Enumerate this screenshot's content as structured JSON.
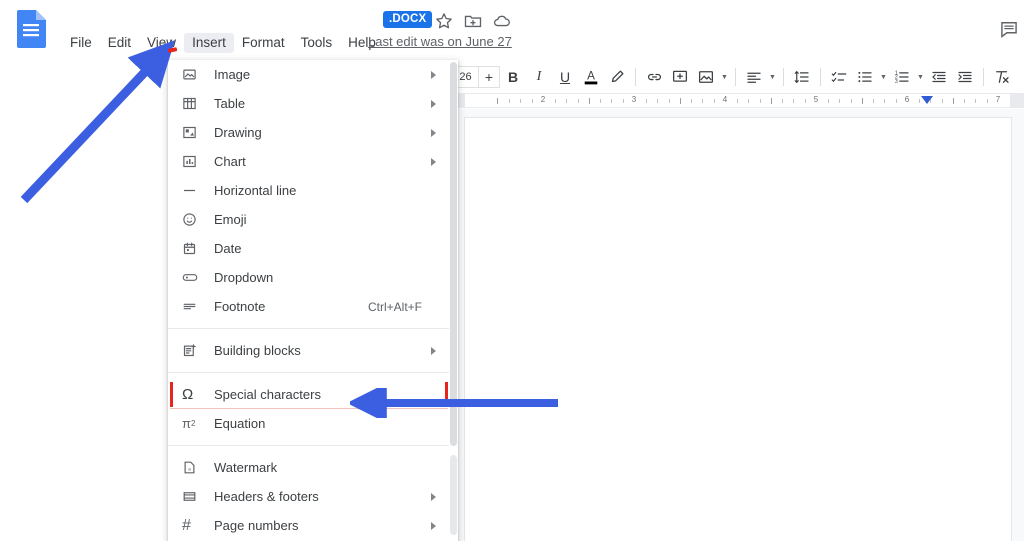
{
  "app": {
    "name": "Google Docs",
    "logo_icon": "google-docs-logo-icon"
  },
  "header": {
    "menus": [
      {
        "label": "File",
        "name": "menu-file",
        "active": false
      },
      {
        "label": "Edit",
        "name": "menu-edit",
        "active": false
      },
      {
        "label": "View",
        "name": "menu-view",
        "active": false
      },
      {
        "label": "Insert",
        "name": "menu-insert",
        "active": true
      },
      {
        "label": "Format",
        "name": "menu-format",
        "active": false
      },
      {
        "label": "Tools",
        "name": "menu-tools",
        "active": false
      },
      {
        "label": "Help",
        "name": "menu-help",
        "active": false
      }
    ],
    "last_edit": "Last edit was on June 27",
    "format_badge": ".DOCX",
    "badge_color": "#1a73e8",
    "icons": [
      {
        "name": "star-icon",
        "glyph": "star"
      },
      {
        "name": "move-to-folder-icon",
        "glyph": "folder-move"
      },
      {
        "name": "cloud-saved-icon",
        "glyph": "cloud"
      },
      {
        "name": "open-comment-history-icon",
        "glyph": "comment"
      }
    ]
  },
  "toolbar": {
    "font_size": "26",
    "font_size_increase": "+",
    "items": [
      {
        "name": "bold-button",
        "label": "B"
      },
      {
        "name": "italic-button",
        "label": "I"
      },
      {
        "name": "underline-button",
        "label": "U"
      },
      {
        "name": "text-color-button",
        "label": "A"
      },
      {
        "name": "highlight-color-button",
        "label": "pen-icon"
      },
      {
        "name": "insert-link-button",
        "label": "link-icon"
      },
      {
        "name": "add-comment-button",
        "label": "comment-plus-icon"
      },
      {
        "name": "insert-image-button",
        "label": "image-icon"
      },
      {
        "name": "align-button",
        "label": "align-left-icon"
      },
      {
        "name": "line-spacing-button",
        "label": "line-spacing-icon"
      },
      {
        "name": "checklist-button",
        "label": "checklist-icon"
      },
      {
        "name": "bulleted-list-button",
        "label": "bulleted-list-icon"
      },
      {
        "name": "numbered-list-button",
        "label": "numbered-list-icon"
      },
      {
        "name": "decrease-indent-button",
        "label": "decrease-indent-icon"
      },
      {
        "name": "increase-indent-button",
        "label": "increase-indent-icon"
      },
      {
        "name": "clear-formatting-button",
        "label": "clear-formatting-icon"
      }
    ]
  },
  "ruler": {
    "numbers": [
      "2",
      "3",
      "4",
      "5",
      "6",
      "7"
    ],
    "indent_marker": "right-indent-marker"
  },
  "insert_menu": {
    "items": [
      {
        "type": "item",
        "label": "Image",
        "icon": "image-icon",
        "name": "insert-menu-image",
        "submenu": true,
        "accel": ""
      },
      {
        "type": "item",
        "label": "Table",
        "icon": "table-icon",
        "name": "insert-menu-table",
        "submenu": true,
        "accel": ""
      },
      {
        "type": "item",
        "label": "Drawing",
        "icon": "drawing-icon",
        "name": "insert-menu-drawing",
        "submenu": true,
        "accel": ""
      },
      {
        "type": "item",
        "label": "Chart",
        "icon": "chart-icon",
        "name": "insert-menu-chart",
        "submenu": true,
        "accel": ""
      },
      {
        "type": "item",
        "label": "Horizontal line",
        "icon": "horizontal-line-icon",
        "name": "insert-menu-horizontal-line",
        "submenu": false,
        "accel": ""
      },
      {
        "type": "item",
        "label": "Emoji",
        "icon": "emoji-icon",
        "name": "insert-menu-emoji",
        "submenu": false,
        "accel": ""
      },
      {
        "type": "item",
        "label": "Date",
        "icon": "date-icon",
        "name": "insert-menu-date",
        "submenu": false,
        "accel": ""
      },
      {
        "type": "item",
        "label": "Dropdown",
        "icon": "dropdown-icon",
        "name": "insert-menu-dropdown",
        "submenu": false,
        "accel": ""
      },
      {
        "type": "item",
        "label": "Footnote",
        "icon": "footnote-icon",
        "name": "insert-menu-footnote",
        "submenu": false,
        "accel": "Ctrl+Alt+F"
      },
      {
        "type": "separator"
      },
      {
        "type": "item",
        "label": "Building blocks",
        "icon": "building-blocks-icon",
        "name": "insert-menu-building-blocks",
        "submenu": true,
        "accel": ""
      },
      {
        "type": "separator"
      },
      {
        "type": "item",
        "label": "Special characters",
        "icon": "omega-icon",
        "name": "insert-menu-special-characters",
        "submenu": false,
        "accel": "",
        "highlighted": true
      },
      {
        "type": "item",
        "label": "Equation",
        "icon": "equation-icon",
        "name": "insert-menu-equation",
        "submenu": false,
        "accel": ""
      },
      {
        "type": "separator"
      },
      {
        "type": "item",
        "label": "Watermark",
        "icon": "watermark-icon",
        "name": "insert-menu-watermark",
        "submenu": false,
        "accel": ""
      },
      {
        "type": "item",
        "label": "Headers & footers",
        "icon": "headers-footers-icon",
        "name": "insert-menu-headers-footers",
        "submenu": true,
        "accel": ""
      },
      {
        "type": "item",
        "label": "Page numbers",
        "icon": "page-numbers-icon",
        "name": "insert-menu-page-numbers",
        "submenu": true,
        "accel": ""
      }
    ]
  },
  "annotations": {
    "arrow_color": "#3b5fe0",
    "marker_color": "#e8241c",
    "arrow_to_insert": "arrow-pointing-to-insert-menu",
    "arrow_to_special_characters": "arrow-pointing-to-special-characters"
  },
  "document": {
    "page_background": "#ffffff",
    "canvas_background": "#f8f9fa"
  }
}
